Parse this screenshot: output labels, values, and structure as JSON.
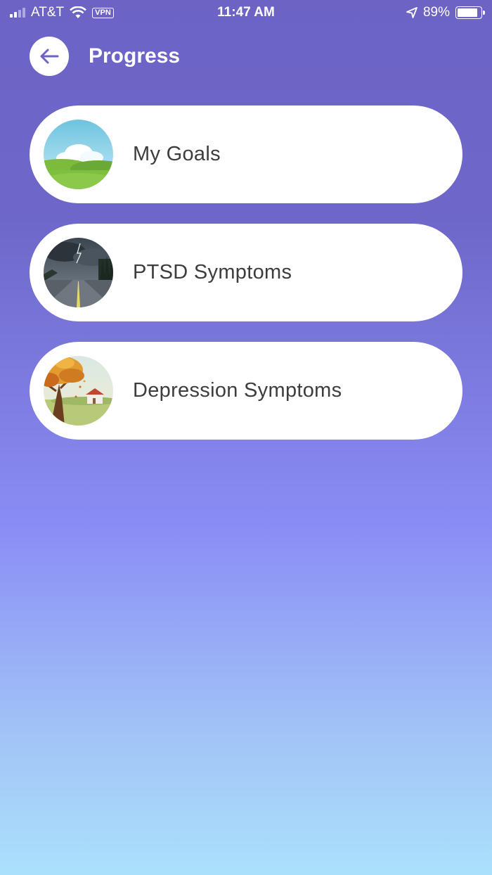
{
  "status_bar": {
    "carrier": "AT&T",
    "vpn": "VPN",
    "time": "11:47 AM",
    "battery": "89%",
    "battery_level": 0.89,
    "icons": [
      "signal-icon",
      "wifi-icon",
      "location-arrow-icon",
      "battery-icon"
    ]
  },
  "header": {
    "title": "Progress",
    "back_icon": "arrow-left-icon"
  },
  "items": [
    {
      "label": "My Goals",
      "image": "green-hills-sky"
    },
    {
      "label": "PTSD Symptoms",
      "image": "stormy-road"
    },
    {
      "label": "Depression Symptoms",
      "image": "autumn-tree-farmhouse"
    }
  ],
  "colors": {
    "gradient_top": "#6c63c5",
    "gradient_bottom": "#abe0fc",
    "accent": "#6c63c5",
    "text": "#3d3d3d"
  }
}
